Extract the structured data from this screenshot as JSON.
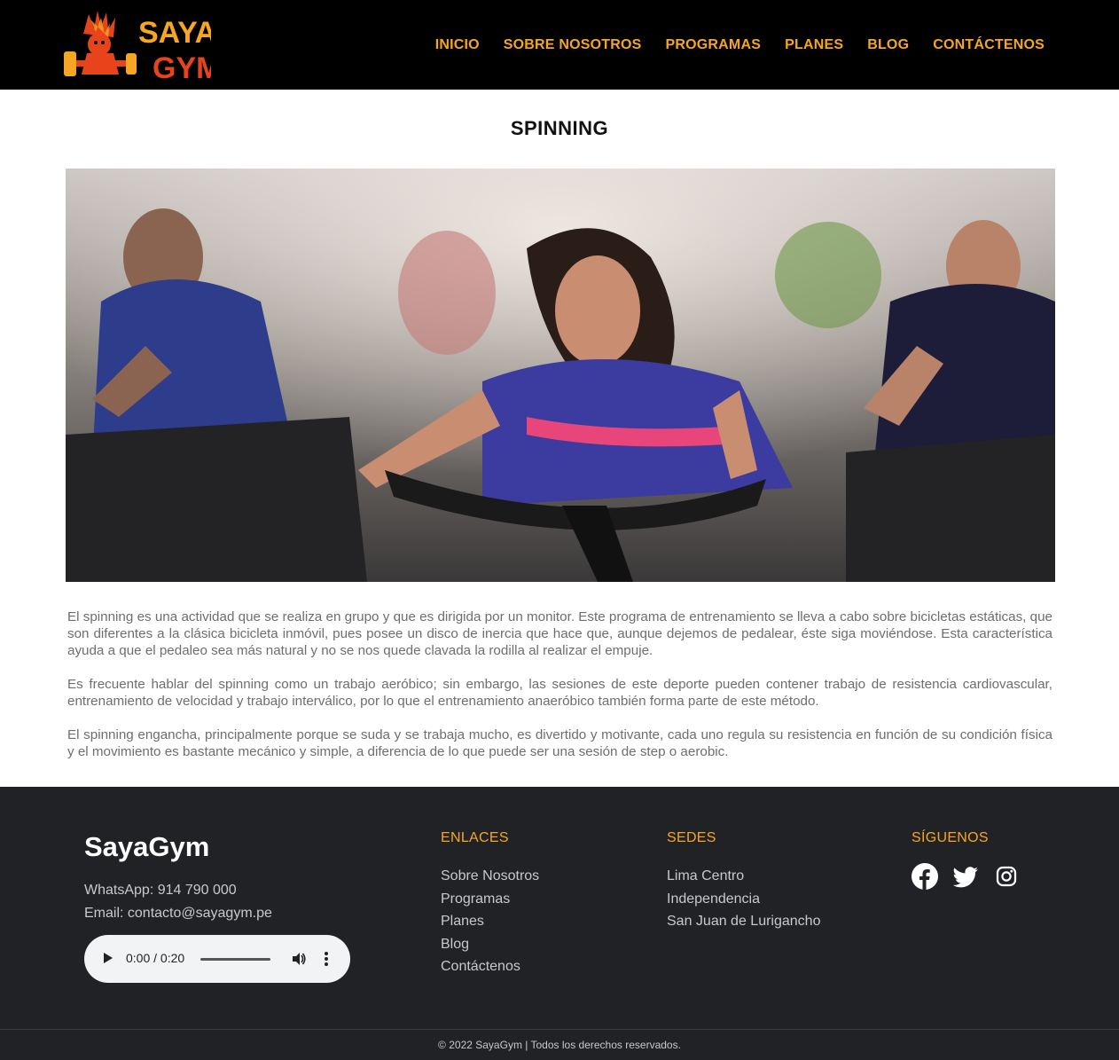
{
  "header": {
    "logo_text_top": "SAYA",
    "logo_text_bottom": "GYM",
    "nav": [
      {
        "label": "INICIO"
      },
      {
        "label": "SOBRE NOSOTROS"
      },
      {
        "label": "PROGRAMAS"
      },
      {
        "label": "PLANES"
      },
      {
        "label": "BLOG"
      },
      {
        "label": "CONTÁCTENOS"
      }
    ]
  },
  "main": {
    "title": "SPINNING",
    "paragraphs": [
      "El spinning es una actividad que se realiza en grupo y que es dirigida por un monitor. Este programa de entrenamiento se lleva a cabo sobre bicicletas estáticas, que son diferentes a la clásica bicicleta inmóvil, pues posee un disco de inercia que hace que, aunque dejemos de pedalear, éste siga moviéndose. Esta característica ayuda a que el pedaleo sea más natural y no se nos quede clavada la rodilla al realizar el empuje.",
      "Es frecuente hablar del spinning como un trabajo aeróbico; sin embargo, las sesiones de este deporte pueden contener trabajo de resistencia cardiovascular, entrenamiento de velocidad y trabajo interválico, por lo que el entrenamiento anaeróbico también forma parte de este método.",
      "El spinning engancha, principalmente porque se suda y se trabaja mucho, es divertido y motivante, cada uno regula su resistencia en función de su condición física y el movimiento es bastante mecánico y simple, a diferencia de lo que puede ser una sesión de step o aerobic."
    ]
  },
  "footer": {
    "brand": "SayaGym",
    "whatsapp": "WhatsApp: 914 790 000",
    "email": "Email: contacto@sayagym.pe",
    "audio_time": "0:00 / 0:20",
    "enlaces_title": "ENLACES",
    "enlaces": [
      "Sobre Nosotros",
      "Programas",
      "Planes",
      "Blog",
      "Contáctenos"
    ],
    "sedes_title": "SEDES",
    "sedes": [
      "Lima Centro",
      "Independencia",
      "San Juan de Lurigancho"
    ],
    "siguenos_title": "SÍGUENOS",
    "social_icons": [
      "facebook-icon",
      "twitter-icon",
      "instagram-icon"
    ],
    "copyright": "© 2022 SayaGym | Todos los derechos reservados."
  },
  "colors": {
    "accent": "#f5a623",
    "header_bg": "#000000",
    "footer_bg": "#212226"
  }
}
